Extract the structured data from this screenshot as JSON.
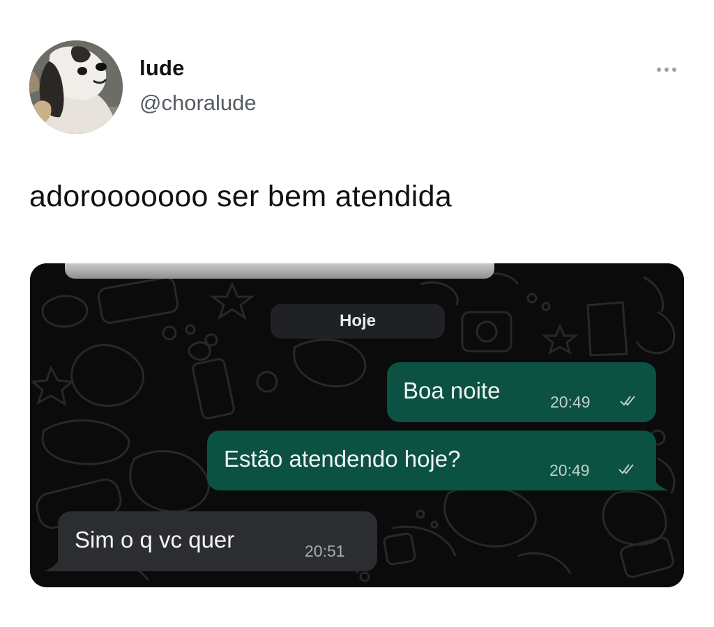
{
  "author": {
    "display_name": "lude",
    "handle": "@choralude",
    "avatar_icon": "dog-photo-avatar"
  },
  "tweet": {
    "text": "adorooooooo ser bem atendida",
    "more_icon": "more-dots-icon"
  },
  "chat": {
    "date_chip": "Hoje",
    "messages": [
      {
        "direction": "outgoing",
        "text": "Boa noite",
        "time": "20:49",
        "status_icon": "double-check-icon"
      },
      {
        "direction": "outgoing",
        "text": "Estão atendendo hoje?",
        "time": "20:49",
        "status_icon": "double-check-icon"
      },
      {
        "direction": "incoming",
        "text": "Sim o q vc quer",
        "time": "20:51"
      }
    ],
    "colors": {
      "background": "#0b0b0c",
      "outgoing_bubble": "#0b5242",
      "incoming_bubble": "#2b2d30",
      "date_chip": "#1f2124"
    }
  }
}
